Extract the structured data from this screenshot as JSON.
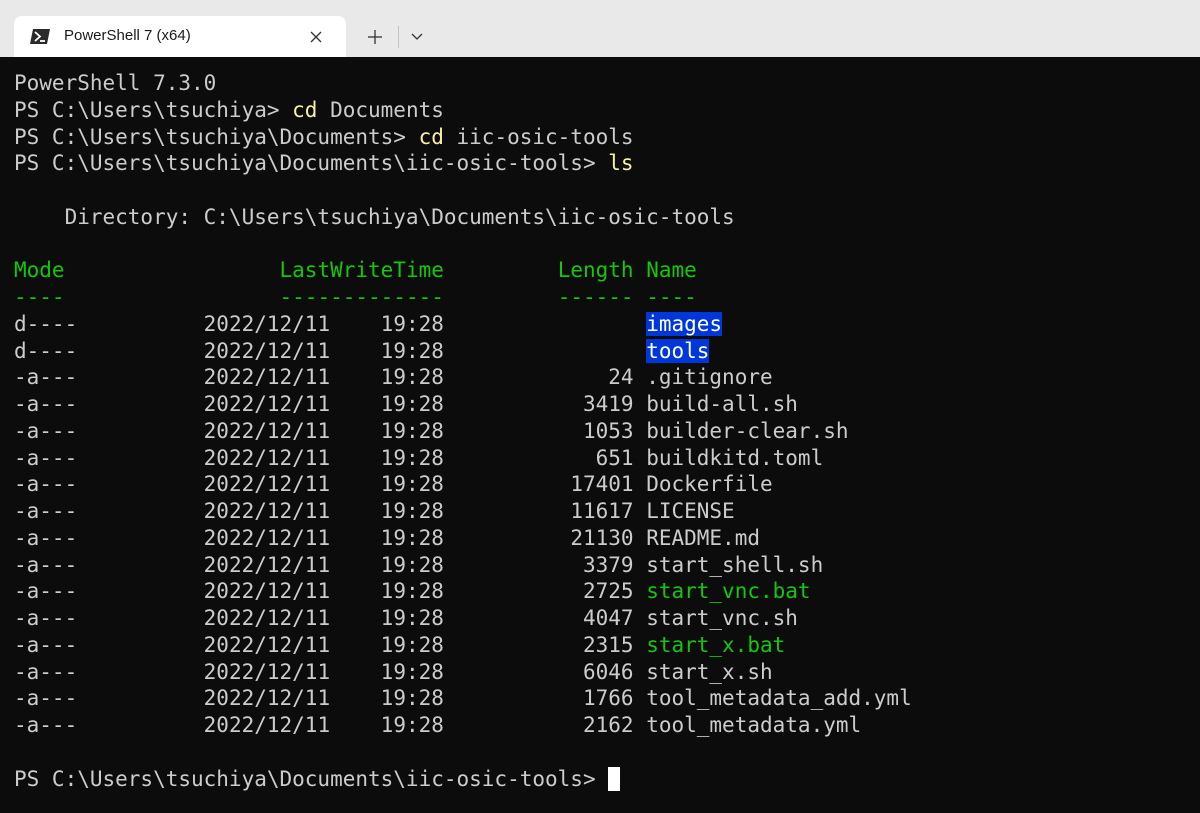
{
  "window": {
    "tab_title": "PowerShell 7 (x64)",
    "tab_icon": "powershell-icon",
    "close_icon": "close-icon",
    "new_tab_icon": "plus-icon",
    "dropdown_icon": "chevron-down-icon"
  },
  "terminal": {
    "banner": "PowerShell 7.3.0",
    "commands": [
      {
        "prompt": "PS C:\\Users\\tsuchiya> ",
        "command": "cd",
        "args": " Documents"
      },
      {
        "prompt": "PS C:\\Users\\tsuchiya\\Documents> ",
        "command": "cd",
        "args": " iic-osic-tools"
      },
      {
        "prompt": "PS C:\\Users\\tsuchiya\\Documents\\iic-osic-tools> ",
        "command": "ls",
        "args": ""
      }
    ],
    "directory_line": "    Directory: C:\\Users\\tsuchiya\\Documents\\iic-osic-tools",
    "columns": {
      "mode": "Mode",
      "last_write_time": "LastWriteTime",
      "length": "Length",
      "name": "Name"
    },
    "entries": [
      {
        "mode": "d----",
        "date": "2022/12/11",
        "time": "19:28",
        "length": "",
        "name": "images",
        "kind": "dir"
      },
      {
        "mode": "d----",
        "date": "2022/12/11",
        "time": "19:28",
        "length": "",
        "name": "tools",
        "kind": "dir"
      },
      {
        "mode": "-a---",
        "date": "2022/12/11",
        "time": "19:28",
        "length": "24",
        "name": ".gitignore",
        "kind": "file"
      },
      {
        "mode": "-a---",
        "date": "2022/12/11",
        "time": "19:28",
        "length": "3419",
        "name": "build-all.sh",
        "kind": "file"
      },
      {
        "mode": "-a---",
        "date": "2022/12/11",
        "time": "19:28",
        "length": "1053",
        "name": "builder-clear.sh",
        "kind": "file"
      },
      {
        "mode": "-a---",
        "date": "2022/12/11",
        "time": "19:28",
        "length": "651",
        "name": "buildkitd.toml",
        "kind": "file"
      },
      {
        "mode": "-a---",
        "date": "2022/12/11",
        "time": "19:28",
        "length": "17401",
        "name": "Dockerfile",
        "kind": "file"
      },
      {
        "mode": "-a---",
        "date": "2022/12/11",
        "time": "19:28",
        "length": "11617",
        "name": "LICENSE",
        "kind": "file"
      },
      {
        "mode": "-a---",
        "date": "2022/12/11",
        "time": "19:28",
        "length": "21130",
        "name": "README.md",
        "kind": "file"
      },
      {
        "mode": "-a---",
        "date": "2022/12/11",
        "time": "19:28",
        "length": "3379",
        "name": "start_shell.sh",
        "kind": "file"
      },
      {
        "mode": "-a---",
        "date": "2022/12/11",
        "time": "19:28",
        "length": "2725",
        "name": "start_vnc.bat",
        "kind": "exe"
      },
      {
        "mode": "-a---",
        "date": "2022/12/11",
        "time": "19:28",
        "length": "4047",
        "name": "start_vnc.sh",
        "kind": "file"
      },
      {
        "mode": "-a---",
        "date": "2022/12/11",
        "time": "19:28",
        "length": "2315",
        "name": "start_x.bat",
        "kind": "exe"
      },
      {
        "mode": "-a---",
        "date": "2022/12/11",
        "time": "19:28",
        "length": "6046",
        "name": "start_x.sh",
        "kind": "file"
      },
      {
        "mode": "-a---",
        "date": "2022/12/11",
        "time": "19:28",
        "length": "1766",
        "name": "tool_metadata_add.yml",
        "kind": "file"
      },
      {
        "mode": "-a---",
        "date": "2022/12/11",
        "time": "19:28",
        "length": "2162",
        "name": "tool_metadata.yml",
        "kind": "file"
      }
    ],
    "final_prompt": "PS C:\\Users\\tsuchiya\\Documents\\iic-osic-tools> "
  },
  "colors": {
    "background": "#0c0c0c",
    "foreground": "#cccccc",
    "command": "#f9f1a5",
    "header": "#16c60c",
    "executable": "#16c60c",
    "directory_highlight": "#0037da"
  }
}
